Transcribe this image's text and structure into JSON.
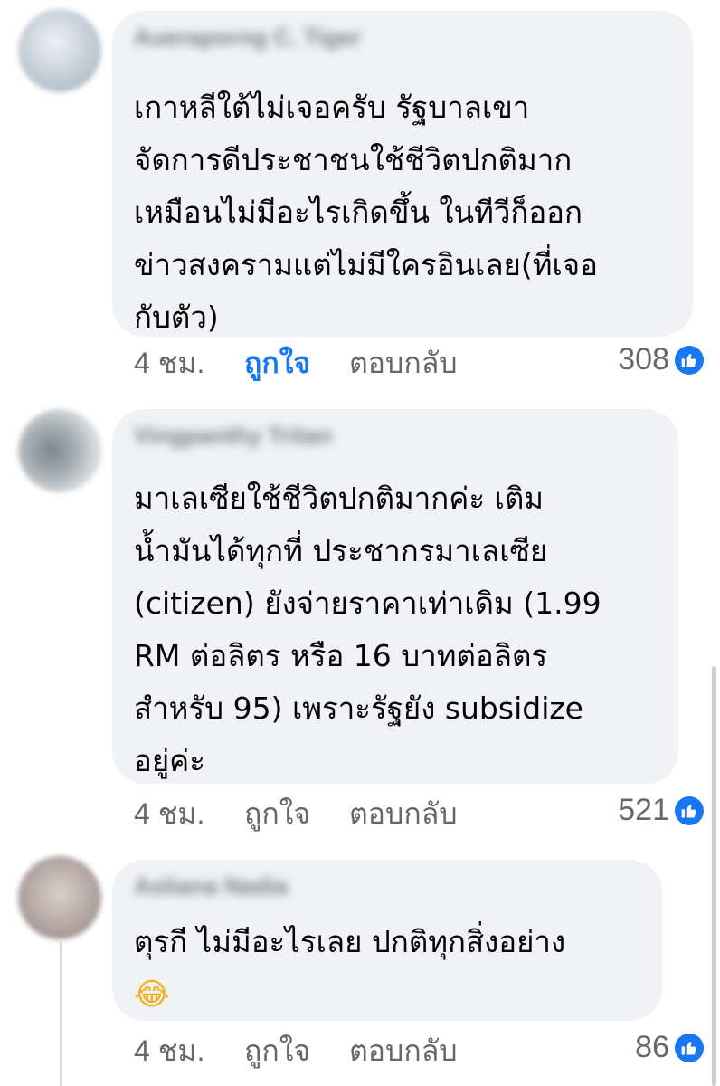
{
  "comments": [
    {
      "author": "Aueraporng C. Tiger",
      "text": "เกาหลีใต้ไม่เจอครับ รัฐบาลเขา\nจัดการดีประชาชนใช้ชีวิตปกติมาก\nเหมือนไม่มีอะไรเกิดขึ้น ในทีวีก็ออก\nข่าวสงครามแต่ไม่มีใครอินเลย(ที่เจอ\nกับตัว)",
      "time": "4 ชม.",
      "like_label": "ถูกใจ",
      "liked": true,
      "reply_label": "ตอบกลับ",
      "reaction_count": "308",
      "reaction_icon": "like-icon"
    },
    {
      "author": "Vingpanthy Tritan",
      "text": "มาเลเซียใช้ชีวิตปกติมากค่ะ เติม\nน้ำมันได้ทุกที่ ประชากรมาเลเซีย\n(citizen) ยังจ่ายราคาเท่าเดิม (1.99\nRM ต่อลิตร หรือ 16 บาทต่อลิตร\nสำหรับ 95) เพราะรัฐยัง subsidize\nอยู่ค่ะ",
      "time": "4 ชม.",
      "like_label": "ถูกใจ",
      "liked": false,
      "reply_label": "ตอบกลับ",
      "reaction_count": "521",
      "reaction_icon": "like-icon"
    },
    {
      "author": "Asliana Nadia",
      "text": "ตุรกี ไม่มีอะไรเลย ปกติทุกสิ่งอย่าง",
      "emoji": "😂",
      "time": "4 ชม.",
      "like_label": "ถูกใจ",
      "liked": false,
      "reply_label": "ตอบกลับ",
      "reaction_count": "86",
      "reaction_icon": "like-icon"
    }
  ],
  "colors": {
    "bubble_bg": "#f0f2f5",
    "meta_text": "#65676b",
    "like_active": "#1877f2",
    "like_icon_bg": "#1877f2"
  }
}
